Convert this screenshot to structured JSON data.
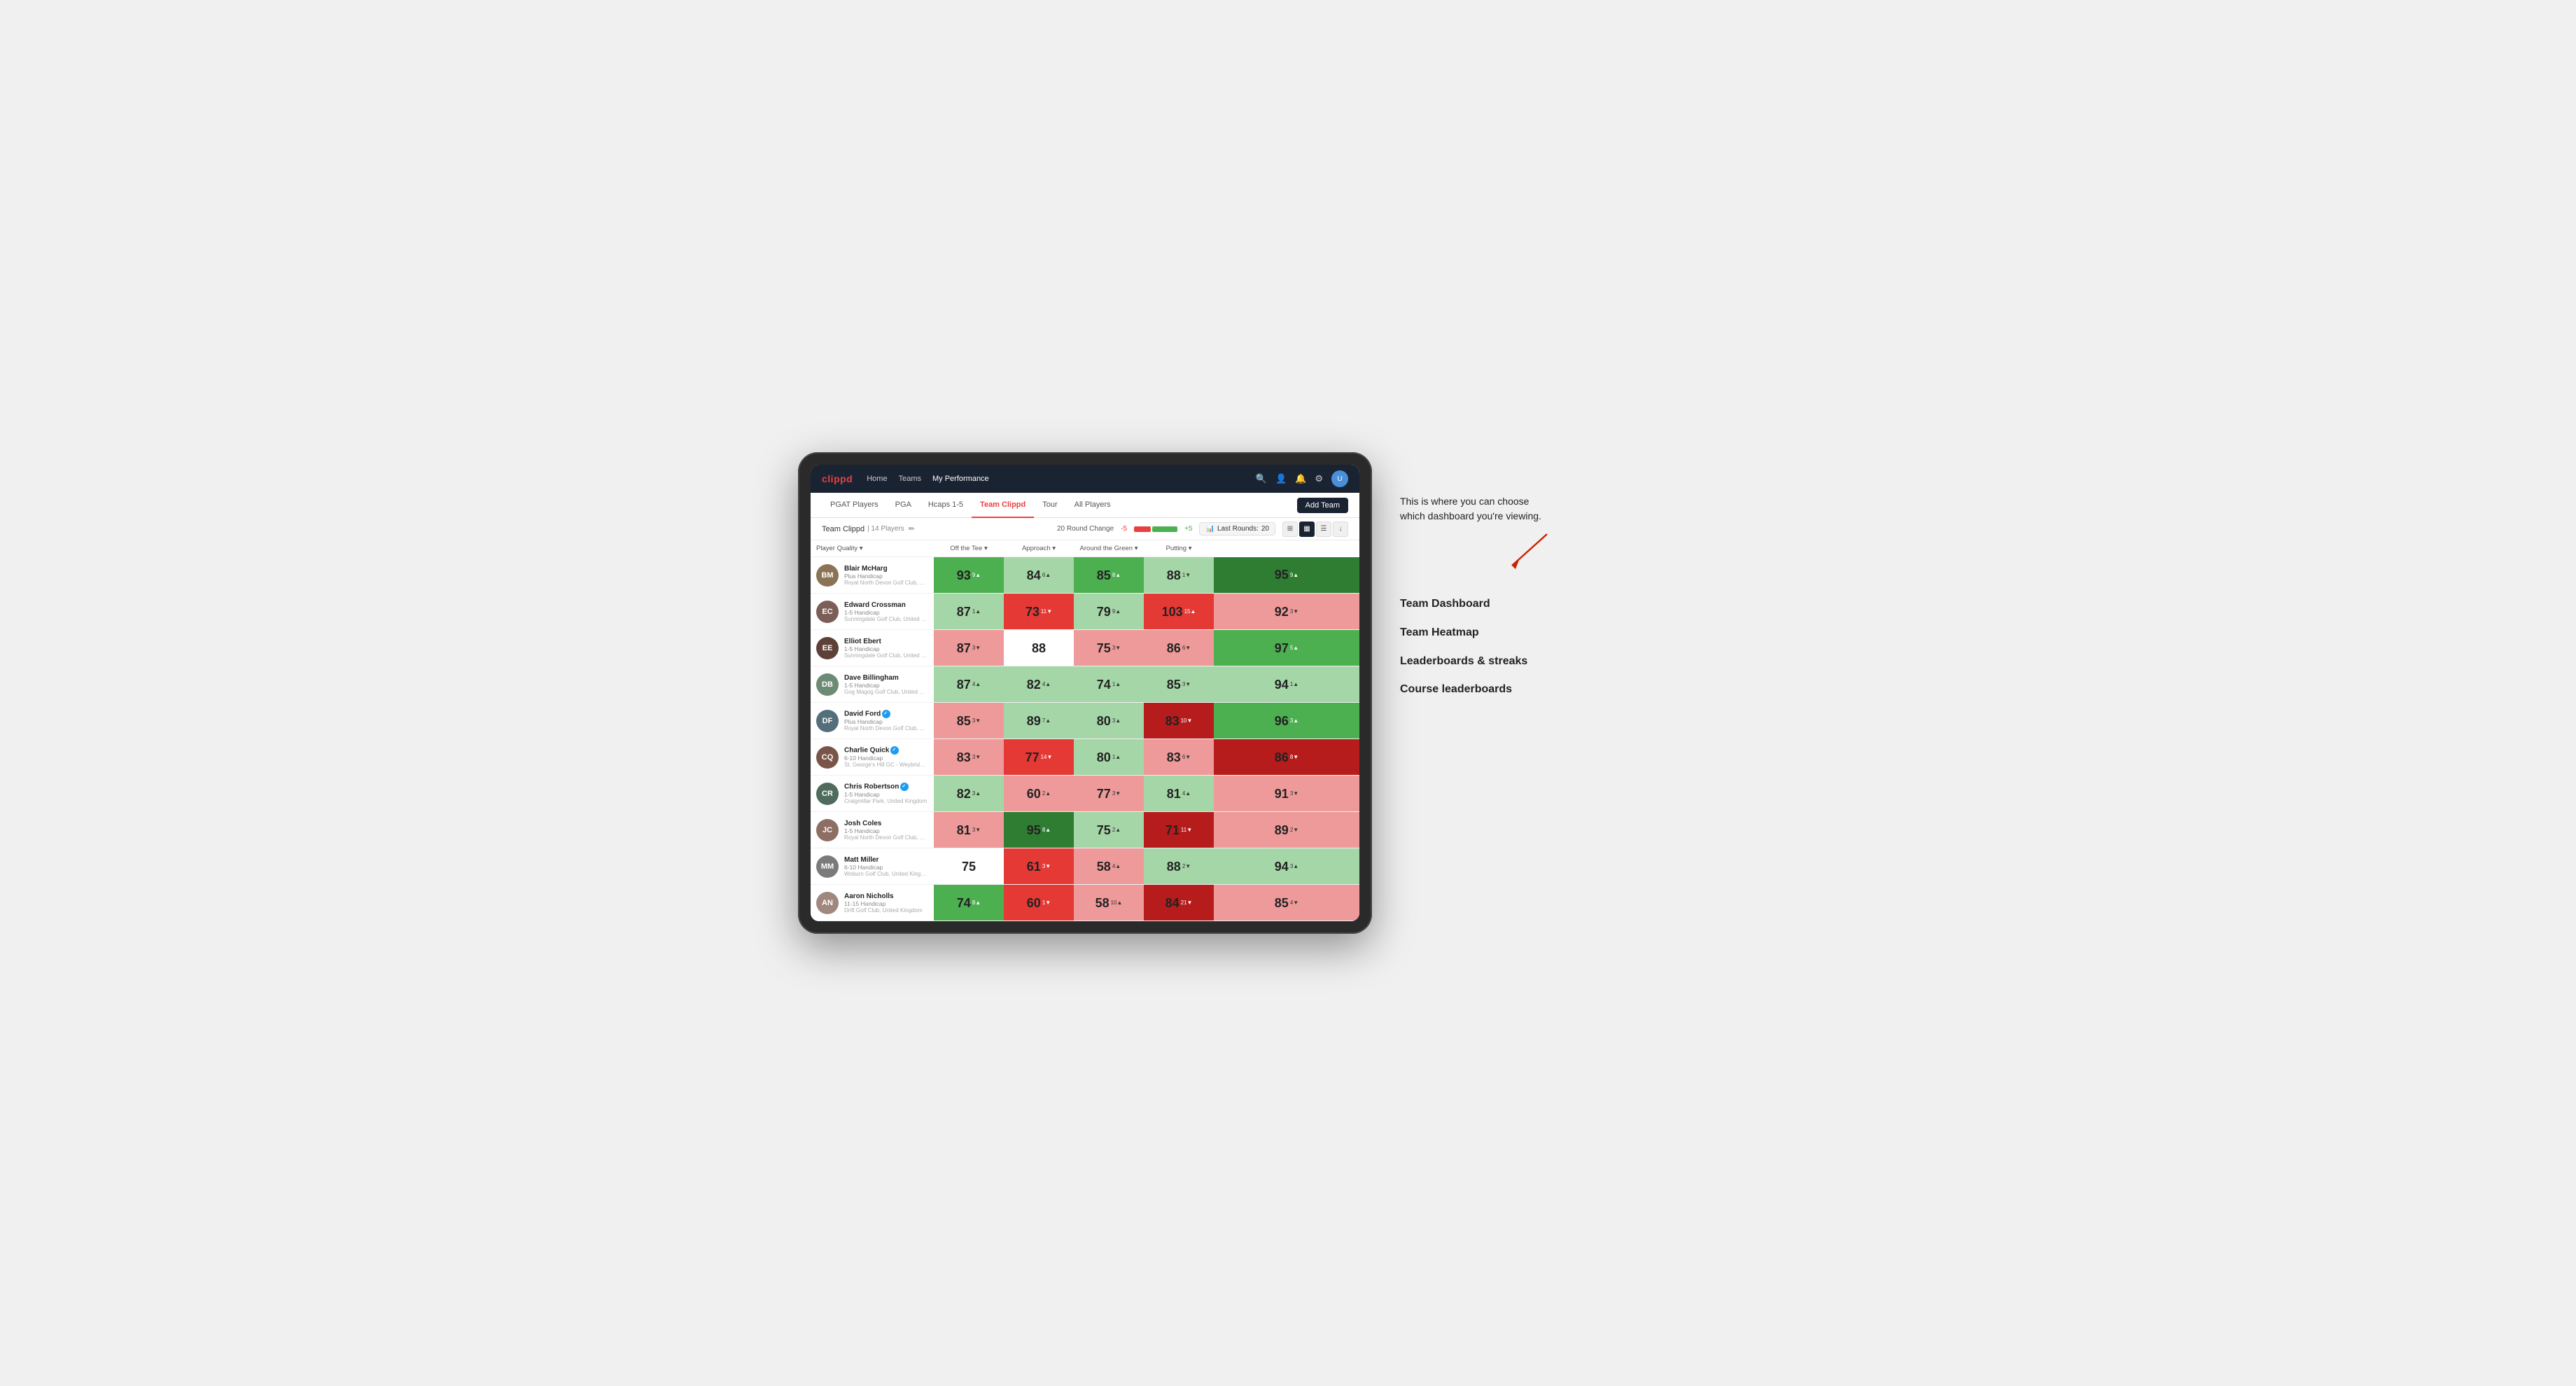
{
  "annotation": {
    "intro_text": "This is where you can choose which dashboard you're viewing.",
    "items": [
      "Team Dashboard",
      "Team Heatmap",
      "Leaderboards & streaks",
      "Course leaderboards"
    ]
  },
  "nav": {
    "logo": "clippd",
    "links": [
      "Home",
      "Teams",
      "My Performance"
    ],
    "active_link": "My Performance"
  },
  "sub_nav": {
    "links": [
      "PGAT Players",
      "PGA",
      "Hcaps 1-5",
      "Team Clippd",
      "Tour",
      "All Players"
    ],
    "active_link": "Team Clippd",
    "add_team_label": "Add Team"
  },
  "team_header": {
    "team_name": "Team Clippd",
    "player_count": "14 Players",
    "round_change_label": "20 Round Change",
    "neg_label": "-5",
    "pos_label": "+5",
    "last_rounds_label": "Last Rounds:",
    "last_rounds_value": "20"
  },
  "table": {
    "columns": [
      "Player Quality ▾",
      "Off the Tee ▾",
      "Approach ▾",
      "Around the Green ▾",
      "Putting ▾"
    ],
    "players": [
      {
        "name": "Blair McHarg",
        "hcp": "Plus Handicap",
        "club": "Royal North Devon Golf Club, United Kingdom",
        "initials": "BM",
        "avatar_color": "#8B7355",
        "stats": [
          {
            "value": "93",
            "change": "9",
            "dir": "up",
            "bg": "bg-green-mid"
          },
          {
            "value": "84",
            "change": "6",
            "dir": "up",
            "bg": "bg-green-light"
          },
          {
            "value": "85",
            "change": "8",
            "dir": "up",
            "bg": "bg-green-mid"
          },
          {
            "value": "88",
            "change": "1",
            "dir": "down",
            "bg": "bg-green-light"
          },
          {
            "value": "95",
            "change": "9",
            "dir": "up",
            "bg": "bg-green-strong"
          }
        ]
      },
      {
        "name": "Edward Crossman",
        "hcp": "1-5 Handicap",
        "club": "Sunningdale Golf Club, United Kingdom",
        "initials": "EC",
        "avatar_color": "#7B5E57",
        "stats": [
          {
            "value": "87",
            "change": "1",
            "dir": "up",
            "bg": "bg-green-light"
          },
          {
            "value": "73",
            "change": "11",
            "dir": "down",
            "bg": "bg-red-mid"
          },
          {
            "value": "79",
            "change": "9",
            "dir": "up",
            "bg": "bg-green-light"
          },
          {
            "value": "103",
            "change": "15",
            "dir": "up",
            "bg": "bg-red-mid"
          },
          {
            "value": "92",
            "change": "3",
            "dir": "down",
            "bg": "bg-red-light"
          }
        ]
      },
      {
        "name": "Elliot Ebert",
        "hcp": "1-5 Handicap",
        "club": "Sunningdale Golf Club, United Kingdom",
        "initials": "EE",
        "avatar_color": "#5D4037",
        "stats": [
          {
            "value": "87",
            "change": "3",
            "dir": "down",
            "bg": "bg-red-light"
          },
          {
            "value": "88",
            "change": "",
            "dir": "",
            "bg": "bg-white"
          },
          {
            "value": "75",
            "change": "3",
            "dir": "down",
            "bg": "bg-red-light"
          },
          {
            "value": "86",
            "change": "6",
            "dir": "down",
            "bg": "bg-red-light"
          },
          {
            "value": "97",
            "change": "5",
            "dir": "up",
            "bg": "bg-green-mid"
          }
        ]
      },
      {
        "name": "Dave Billingham",
        "hcp": "1-5 Handicap",
        "club": "Gog Magog Golf Club, United Kingdom",
        "initials": "DB",
        "avatar_color": "#6D8B74",
        "stats": [
          {
            "value": "87",
            "change": "4",
            "dir": "up",
            "bg": "bg-green-light"
          },
          {
            "value": "82",
            "change": "4",
            "dir": "up",
            "bg": "bg-green-light"
          },
          {
            "value": "74",
            "change": "1",
            "dir": "up",
            "bg": "bg-green-light"
          },
          {
            "value": "85",
            "change": "3",
            "dir": "down",
            "bg": "bg-green-light"
          },
          {
            "value": "94",
            "change": "1",
            "dir": "up",
            "bg": "bg-green-light"
          }
        ]
      },
      {
        "name": "David Ford",
        "hcp": "Plus Handicap",
        "club": "Royal North Devon Golf Club, United Kingdom",
        "initials": "DF",
        "avatar_color": "#546E7A",
        "verified": true,
        "stats": [
          {
            "value": "85",
            "change": "3",
            "dir": "down",
            "bg": "bg-red-light"
          },
          {
            "value": "89",
            "change": "7",
            "dir": "up",
            "bg": "bg-green-light"
          },
          {
            "value": "80",
            "change": "3",
            "dir": "up",
            "bg": "bg-green-light"
          },
          {
            "value": "83",
            "change": "10",
            "dir": "down",
            "bg": "bg-red-strong"
          },
          {
            "value": "96",
            "change": "3",
            "dir": "up",
            "bg": "bg-green-mid"
          }
        ]
      },
      {
        "name": "Charlie Quick",
        "hcp": "6-10 Handicap",
        "club": "St. George's Hill GC - Weybridge - Surrey, Uni...",
        "initials": "CQ",
        "avatar_color": "#795548",
        "verified": true,
        "stats": [
          {
            "value": "83",
            "change": "3",
            "dir": "down",
            "bg": "bg-red-light"
          },
          {
            "value": "77",
            "change": "14",
            "dir": "down",
            "bg": "bg-red-mid"
          },
          {
            "value": "80",
            "change": "1",
            "dir": "up",
            "bg": "bg-green-light"
          },
          {
            "value": "83",
            "change": "6",
            "dir": "down",
            "bg": "bg-red-light"
          },
          {
            "value": "86",
            "change": "8",
            "dir": "down",
            "bg": "bg-red-strong"
          }
        ]
      },
      {
        "name": "Chris Robertson",
        "hcp": "1-5 Handicap",
        "club": "Craigmillar Park, United Kingdom",
        "initials": "CR",
        "avatar_color": "#4E6B5E",
        "verified": true,
        "stats": [
          {
            "value": "82",
            "change": "3",
            "dir": "up",
            "bg": "bg-green-light"
          },
          {
            "value": "60",
            "change": "2",
            "dir": "up",
            "bg": "bg-red-light"
          },
          {
            "value": "77",
            "change": "3",
            "dir": "down",
            "bg": "bg-red-light"
          },
          {
            "value": "81",
            "change": "4",
            "dir": "up",
            "bg": "bg-green-light"
          },
          {
            "value": "91",
            "change": "3",
            "dir": "down",
            "bg": "bg-red-light"
          }
        ]
      },
      {
        "name": "Josh Coles",
        "hcp": "1-5 Handicap",
        "club": "Royal North Devon Golf Club, United Kingdom",
        "initials": "JC",
        "avatar_color": "#8D6E63",
        "stats": [
          {
            "value": "81",
            "change": "3",
            "dir": "down",
            "bg": "bg-red-light"
          },
          {
            "value": "95",
            "change": "8",
            "dir": "up",
            "bg": "bg-green-strong"
          },
          {
            "value": "75",
            "change": "2",
            "dir": "up",
            "bg": "bg-green-light"
          },
          {
            "value": "71",
            "change": "11",
            "dir": "down",
            "bg": "bg-red-strong"
          },
          {
            "value": "89",
            "change": "2",
            "dir": "down",
            "bg": "bg-red-light"
          }
        ]
      },
      {
        "name": "Matt Miller",
        "hcp": "6-10 Handicap",
        "club": "Woburn Golf Club, United Kingdom",
        "initials": "MM",
        "avatar_color": "#7B7B7B",
        "stats": [
          {
            "value": "75",
            "change": "",
            "dir": "",
            "bg": "bg-white"
          },
          {
            "value": "61",
            "change": "3",
            "dir": "down",
            "bg": "bg-red-mid"
          },
          {
            "value": "58",
            "change": "4",
            "dir": "up",
            "bg": "bg-red-light"
          },
          {
            "value": "88",
            "change": "2",
            "dir": "down",
            "bg": "bg-green-light"
          },
          {
            "value": "94",
            "change": "3",
            "dir": "up",
            "bg": "bg-green-light"
          }
        ]
      },
      {
        "name": "Aaron Nicholls",
        "hcp": "11-15 Handicap",
        "club": "Drift Golf Club, United Kingdom",
        "initials": "AN",
        "avatar_color": "#A1887F",
        "stats": [
          {
            "value": "74",
            "change": "8",
            "dir": "up",
            "bg": "bg-green-mid"
          },
          {
            "value": "60",
            "change": "1",
            "dir": "down",
            "bg": "bg-red-mid"
          },
          {
            "value": "58",
            "change": "10",
            "dir": "up",
            "bg": "bg-red-light"
          },
          {
            "value": "84",
            "change": "21",
            "dir": "down",
            "bg": "bg-red-strong"
          },
          {
            "value": "85",
            "change": "4",
            "dir": "down",
            "bg": "bg-red-light"
          }
        ]
      }
    ]
  }
}
